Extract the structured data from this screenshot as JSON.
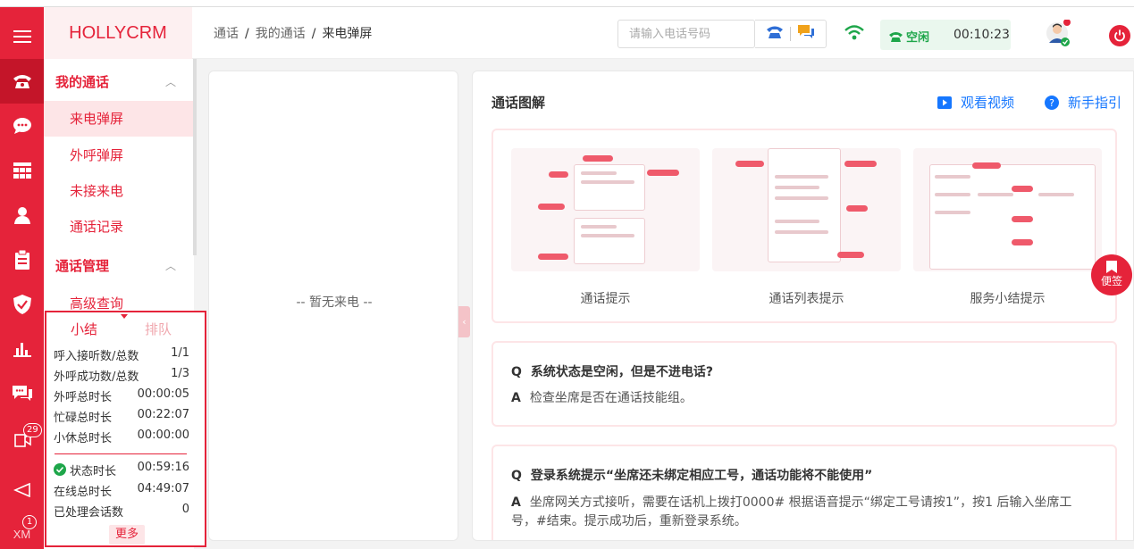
{
  "header": {
    "brand": "HOLLYCRM",
    "breadcrumb": [
      "通话",
      "我的通话",
      "来电弹屏"
    ],
    "phone_placeholder": "请输入电话号码",
    "status_label": "空闲",
    "status_timer": "00:10:23"
  },
  "rail": {
    "badge_notice": "29",
    "badge_xm": "1",
    "xm_label": "XM"
  },
  "sidenav": {
    "group1": "我的通话",
    "group1_items": [
      "来电弹屏",
      "外呼弹屏",
      "未接来电",
      "通话记录"
    ],
    "group2": "通话管理",
    "group2_items": [
      "高级查询"
    ]
  },
  "summary": {
    "tab_summary": "小结",
    "tab_queue": "排队",
    "rows": [
      {
        "label": "呼入接听数/总数",
        "value": "1/1"
      },
      {
        "label": "外呼成功数/总数",
        "value": "1/3"
      },
      {
        "label": "外呼总时长",
        "value": "00:00:05"
      },
      {
        "label": "忙碌总时长",
        "value": "00:22:07"
      },
      {
        "label": "小休总时长",
        "value": "00:00:00"
      }
    ],
    "rows2": [
      {
        "label": "状态时长",
        "value": "00:59:16"
      },
      {
        "label": "在线总时长",
        "value": "04:49:07"
      },
      {
        "label": "已处理会话数",
        "value": "0"
      }
    ],
    "more_label": "更多"
  },
  "left_panel": {
    "empty_text": "-- 暂无来电 --"
  },
  "right_panel": {
    "title": "通话图解",
    "watch_video": "观看视频",
    "guide": "新手指引",
    "diagrams": [
      "通话提示",
      "通话列表提示",
      "服务小结提示"
    ],
    "faq": [
      {
        "q": "系统状态是空闲，但是不进电话?",
        "a": "检查坐席是否在通话技能组。"
      },
      {
        "q": "登录系统提示“坐席还未绑定相应工号，通话功能将不能使用”",
        "a": "坐席网关方式接听，需要在话机上拨打0000# 根据语音提示“绑定工号请按1”，按1 后输入坐席工号，#结束。提示成功后，重新登录系统。"
      }
    ],
    "faq_q_tag": "Q",
    "faq_a_tag": "A"
  },
  "floating": {
    "sticky_note": "便签"
  },
  "colors": {
    "brand_red": "#e5233a",
    "idle_green": "#1ea64a",
    "link_blue": "#1677ff"
  }
}
